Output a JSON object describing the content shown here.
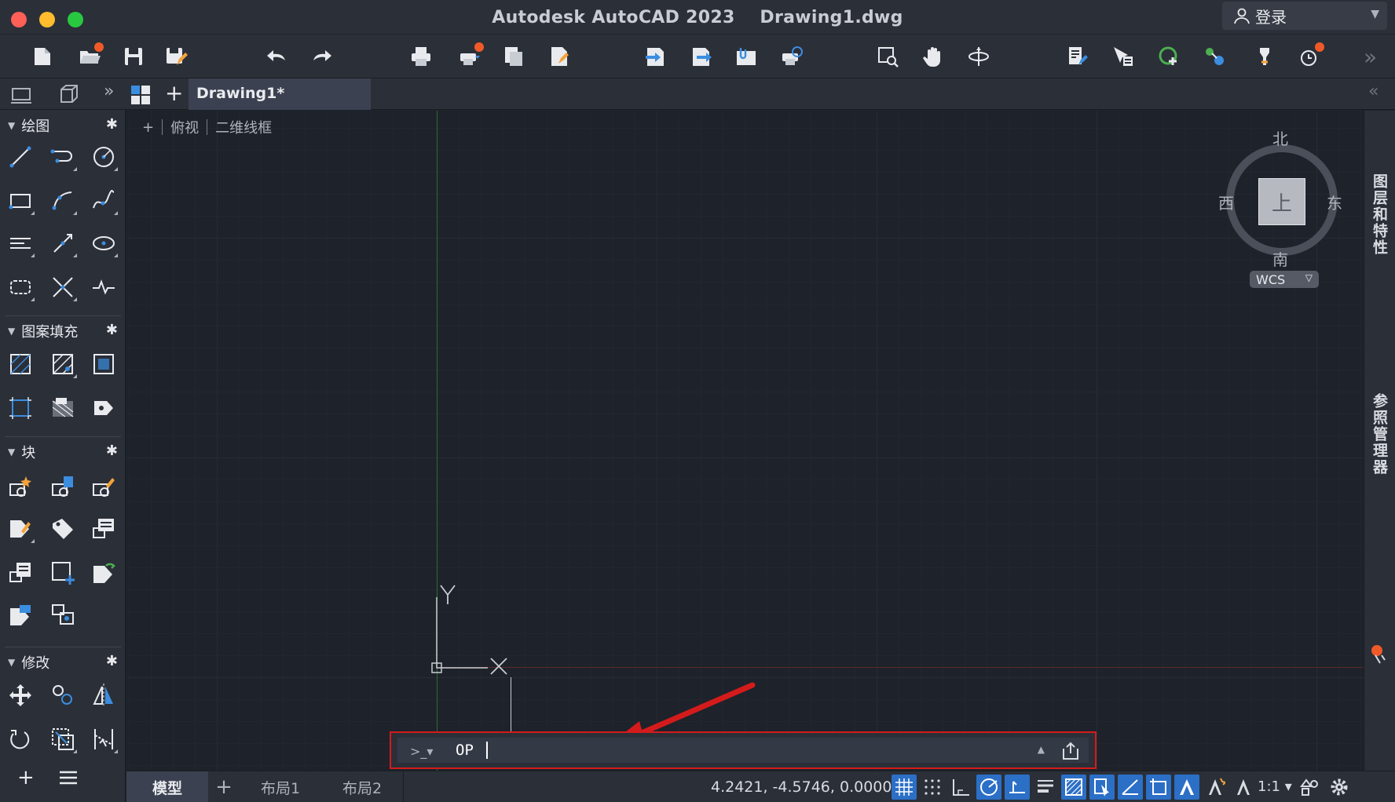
{
  "window": {
    "title": "Autodesk AutoCAD 2023    Drawing1.dwg",
    "login_label": "登录"
  },
  "toolbar": {
    "icons": [
      "new-icon",
      "open-icon",
      "save-icon",
      "save-as-icon",
      "undo-icon",
      "redo-icon",
      "plot-icon",
      "batch-plot-icon",
      "publish-icon",
      "page-setup-icon",
      "import-icon",
      "export-icon",
      "attach-icon",
      "share-view-icon",
      "zoom-window-icon",
      "pan-icon",
      "orbit-icon",
      "layer-properties-icon",
      "match-properties-icon",
      "add-selected-icon",
      "isolate-icon",
      "quickprops-icon",
      "notifications-icon"
    ],
    "overflow": "»"
  },
  "tabs": {
    "overflow": "»",
    "add": "+",
    "active_tab": "Drawing1*",
    "collapse": "«"
  },
  "palette": {
    "sections": [
      {
        "title": "绘图"
      },
      {
        "title": "图案填充"
      },
      {
        "title": "块"
      },
      {
        "title": "修改"
      }
    ]
  },
  "viewport": {
    "plus": "+",
    "view": "俯视",
    "style": "二维线框",
    "compass": {
      "north": "北",
      "south": "南",
      "east": "东",
      "west": "西",
      "top": "上"
    },
    "wcs": "WCS",
    "ucs": {
      "x": "X",
      "y": "Y"
    }
  },
  "right_panels": {
    "layers": "图层和特性",
    "xref": "参照管理器"
  },
  "command_line": {
    "prompt": ">_▾",
    "value": "OP"
  },
  "status_bar": {
    "tabs": [
      "模型",
      "布局1",
      "布局2"
    ],
    "add_tab": "+",
    "coordinates": "4.2421, -4.5746, 0.0000",
    "scale": "1:1 ▾"
  },
  "colors": {
    "accent": "#2b6fc6",
    "highlight_red": "#d41b1b",
    "ucs_green": "#2e6b2e"
  }
}
